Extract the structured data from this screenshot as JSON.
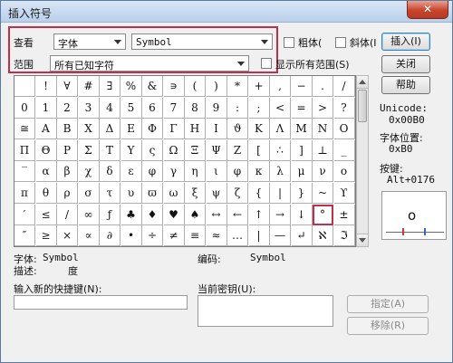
{
  "window": {
    "title": "插入符号",
    "close_icon": "close-icon"
  },
  "view": {
    "label": "查看",
    "font_type": "字体",
    "font_name": "Symbol"
  },
  "range": {
    "label": "范围",
    "value": "所有已知字符",
    "show_all_label": "显示所有范围(S)"
  },
  "options": {
    "bold_label": "粗体(",
    "italic_label": "斜体(I"
  },
  "buttons": {
    "insert": "插入(I)",
    "close": "关闭",
    "help": "帮助",
    "assign": "指定(A)",
    "remove": "移除(R)"
  },
  "info": {
    "unicode_label": "Unicode:",
    "unicode_value": "0x00B0",
    "font_pos_label": "字体位置:",
    "font_pos_value": "0xB0",
    "keys_label": "按键:",
    "keys_value": "Alt+0176"
  },
  "preview": {
    "glyph": "o"
  },
  "status": {
    "font_label": "字体:",
    "font_value": "Symbol",
    "desc_label": "描述:",
    "desc_value": "度",
    "code_label": "编码:",
    "code_value": "Symbol"
  },
  "shortcut": {
    "new_label": "输入新的快捷键(N):",
    "current_label": "当前密钥(U):"
  },
  "symbols": [
    [
      "",
      "!",
      "∀",
      "#",
      "∃",
      "%",
      "&",
      "∍",
      "(",
      ")",
      "*",
      "+",
      ",",
      "−",
      ".",
      "/"
    ],
    [
      "0",
      "1",
      "2",
      "3",
      "4",
      "5",
      "6",
      "7",
      "8",
      "9",
      ":",
      ";",
      "<",
      "=",
      ">",
      "?"
    ],
    [
      "≅",
      "Α",
      "Β",
      "Χ",
      "Δ",
      "Ε",
      "Φ",
      "Γ",
      "Η",
      "Ι",
      "ϑ",
      "Κ",
      "Λ",
      "Μ",
      "Ν",
      "Ο"
    ],
    [
      "Π",
      "Θ",
      "Ρ",
      "Σ",
      "Τ",
      "Υ",
      "ς",
      "Ω",
      "Ξ",
      "Ψ",
      "Ζ",
      "[",
      "∴",
      "]",
      "⊥",
      "_"
    ],
    [
      "‾",
      "α",
      "β",
      "χ",
      "δ",
      "ε",
      "φ",
      "γ",
      "η",
      "ι",
      "φ",
      "κ",
      "λ",
      "μ",
      "ν",
      "ο"
    ],
    [
      "π",
      "θ",
      "ρ",
      "σ",
      "τ",
      "υ",
      "ϖ",
      "ω",
      "ξ",
      "ψ",
      "ζ",
      "{",
      "|",
      "}",
      "~",
      "ϒ"
    ],
    [
      "′",
      "≤",
      "/",
      "∞",
      "ƒ",
      "♣",
      "♦",
      "♥",
      "♠",
      "↔",
      "←",
      "↑",
      "→",
      "↓",
      "°",
      "±"
    ],
    [
      "″",
      "≥",
      "×",
      "∝",
      "∂",
      "•",
      "÷",
      "≠",
      "≡",
      "≈",
      "…",
      "|",
      "—",
      "↵",
      "ℵ",
      "ℑ"
    ]
  ]
}
